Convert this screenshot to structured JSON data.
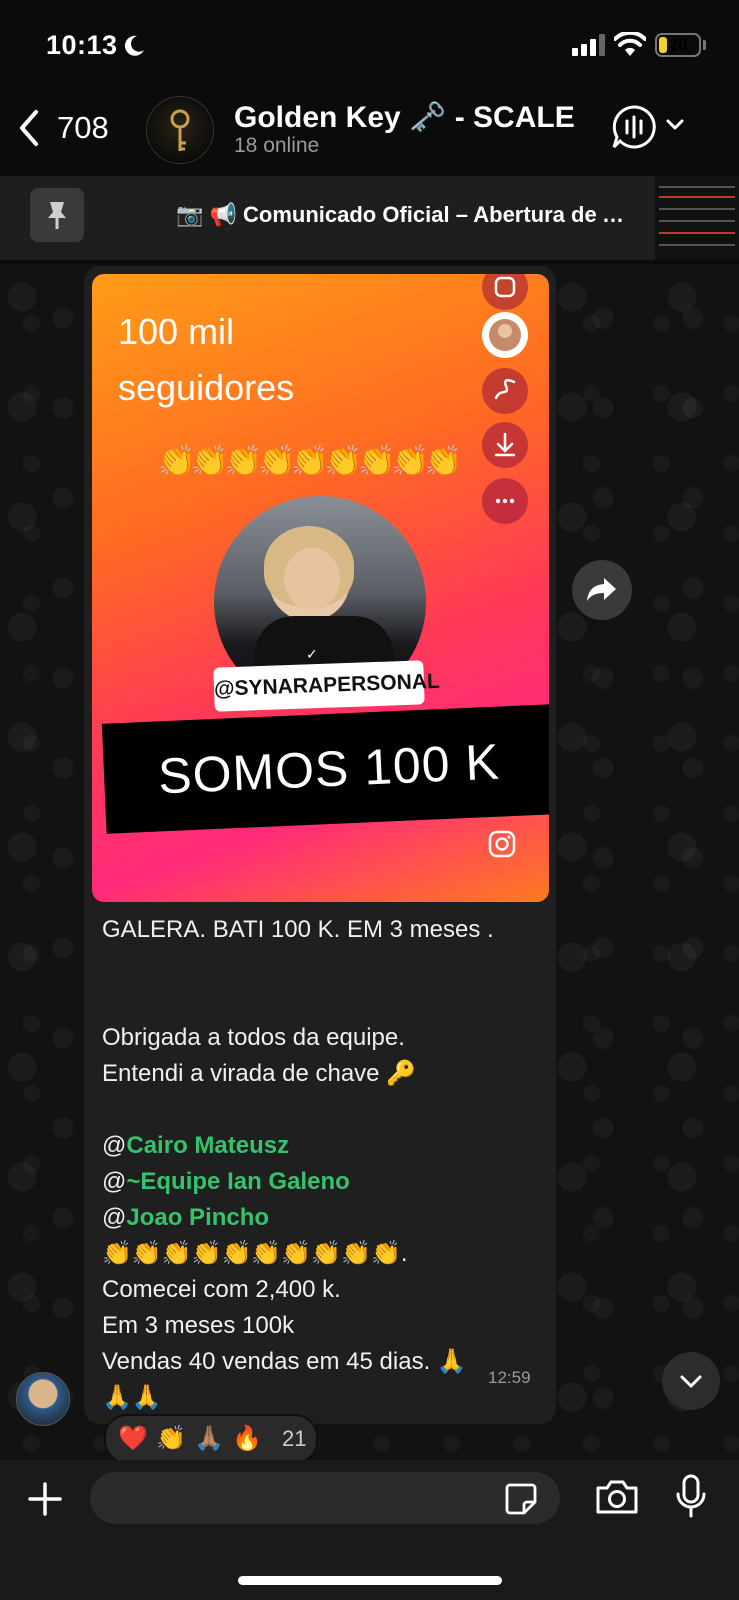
{
  "status_bar": {
    "time": "10:13",
    "battery": "20",
    "battery_level": 0.2
  },
  "header": {
    "back_count": "708",
    "title": "Golden Key 🗝️ - SCALE",
    "subtitle": "18 online"
  },
  "pinned": {
    "text": "📷 📢 Comunicado Oficial – Abertura de Age..."
  },
  "story": {
    "heading": "100 mil seguidores",
    "claps": "👏👏👏👏👏👏👏👏👏",
    "handle": "@SYNARAPERSONAL",
    "banner": "SOMOS 100 K"
  },
  "message": {
    "lines": [
      "GALERA.  BATI 100 K. EM 3 meses .",
      "",
      "",
      "Obrigada a todos da equipe.",
      "Entendi a virada de chave 🔑",
      ""
    ],
    "mentions": [
      "Cairo Mateusz",
      "~Equipe Ian Galeno",
      "Joao Pincho"
    ],
    "lines_after": [
      "👏👏👏👏👏👏👏👏👏👏.",
      "Comecei com 2,400 k.",
      "Em 3 meses 100k",
      "Vendas 40 vendas em 45 dias. 🙏",
      "🙏🙏"
    ],
    "time": "12:59"
  },
  "reactions": {
    "emojis": [
      "❤️",
      "👏",
      "🙏🏽",
      "🔥"
    ],
    "count": "21"
  },
  "composer": {
    "placeholder": ""
  },
  "colors": {
    "mention": "#35c26b",
    "bubble": "#1f1f1f",
    "background": "#121212"
  }
}
